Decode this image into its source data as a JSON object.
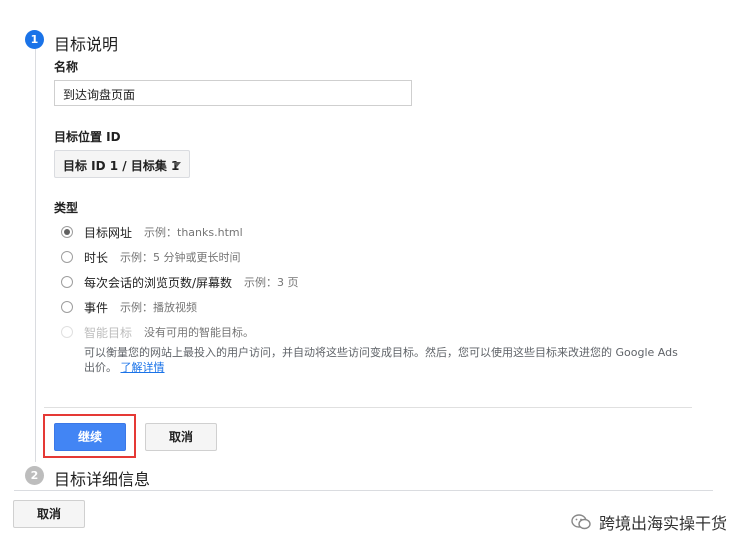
{
  "step1": {
    "number": "1",
    "title": "目标说明"
  },
  "name_field": {
    "label": "名称",
    "value": "到达询盘页面"
  },
  "goal_slot": {
    "label": "目标位置 ID",
    "selected": "目标 ID 1 / 目标集 1"
  },
  "type_section": {
    "label": "类型",
    "options": [
      {
        "label": "目标网址",
        "example": "示例：thanks.html",
        "checked": true,
        "disabled": false
      },
      {
        "label": "时长",
        "example": "示例：5 分钟或更长时间",
        "checked": false,
        "disabled": false
      },
      {
        "label": "每次会话的浏览页数/屏幕数",
        "example": "示例：3 页",
        "checked": false,
        "disabled": false
      },
      {
        "label": "事件",
        "example": "示例：播放视频",
        "checked": false,
        "disabled": false
      },
      {
        "label": "智能目标",
        "example": "没有可用的智能目标。",
        "checked": false,
        "disabled": true
      }
    ],
    "smart_desc": "可以衡量您的网站上最投入的用户访问，并自动将这些访问变成目标。然后，您可以使用这些目标来改进您的 Google Ads 出价。",
    "learn_more": "了解详情"
  },
  "actions": {
    "continue": "继续",
    "cancel": "取消"
  },
  "step2": {
    "number": "2",
    "title": "目标详细信息"
  },
  "footer": {
    "cancel": "取消"
  },
  "watermark": {
    "text": "跨境出海实操干货"
  },
  "colors": {
    "accent": "#1a73e8",
    "primary_button": "#4285f4",
    "highlight": "#e53935"
  }
}
